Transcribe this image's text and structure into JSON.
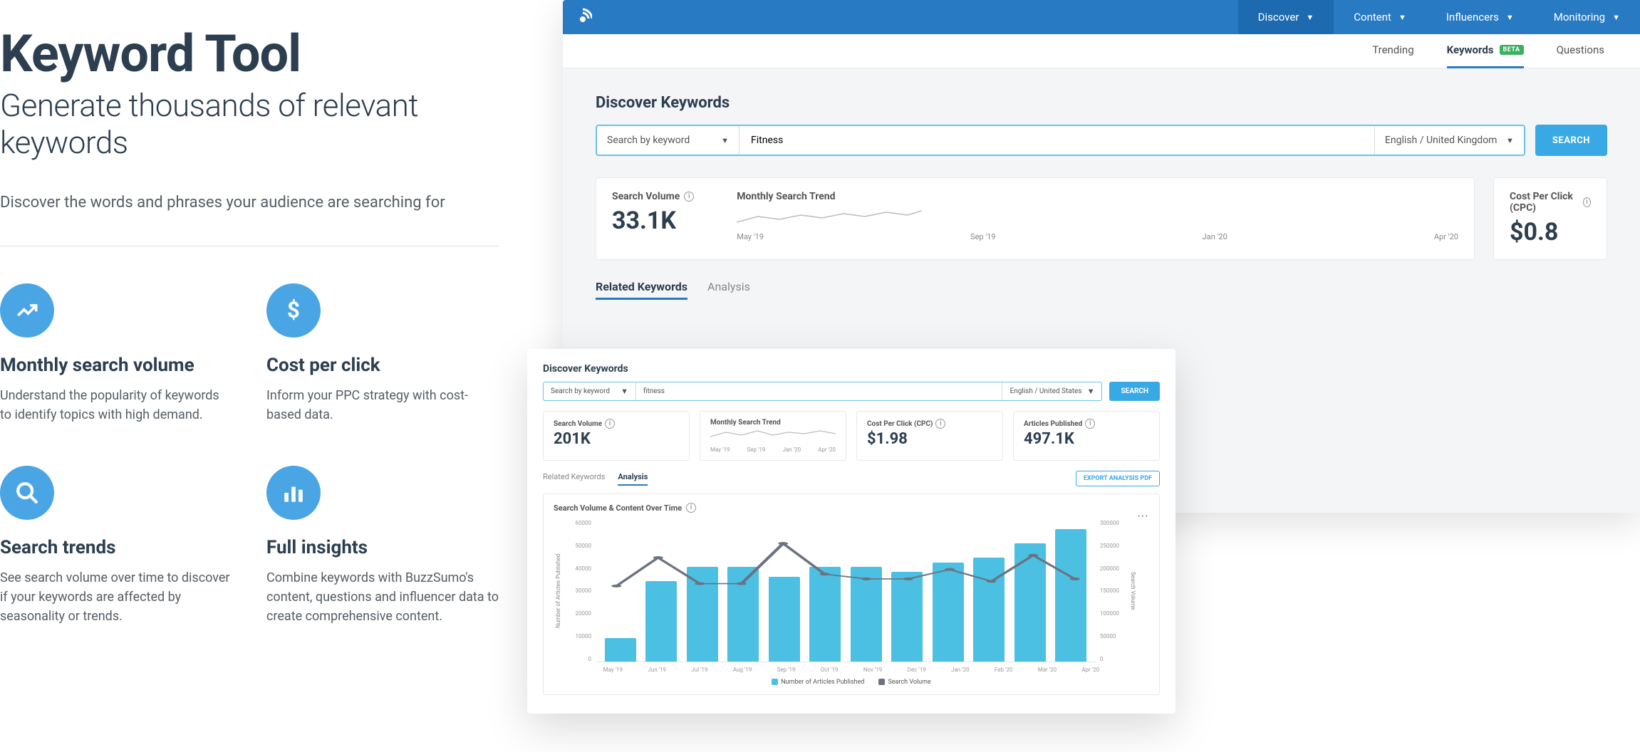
{
  "left": {
    "title": "Keyword Tool",
    "subtitle": "Generate thousands of relevant keywords",
    "tagline": "Discover the words and phrases your audience are searching for",
    "features": [
      {
        "icon": "trend",
        "title": "Monthly search volume",
        "desc": "Understand the popularity of keywords to identify topics with high demand."
      },
      {
        "icon": "dollar",
        "title": "Cost per click",
        "desc": "Inform your PPC strategy with cost-based data."
      },
      {
        "icon": "search",
        "title": "Search trends",
        "desc": "See search volume over time to discover if your keywords are affected by seasonality or trends."
      },
      {
        "icon": "bars",
        "title": "Full insights",
        "desc": "Combine keywords with BuzzSumo's content, questions and influencer data to create comprehensive content."
      }
    ]
  },
  "app1": {
    "nav": [
      "Discover",
      "Content",
      "Influencers",
      "Monitoring"
    ],
    "nav_active": "Discover",
    "subnav": {
      "trending": "Trending",
      "keywords": "Keywords",
      "beta": "BETA",
      "questions": "Questions"
    },
    "heading": "Discover Keywords",
    "search_mode": "Search by keyword",
    "search_value": "Fitness",
    "lang": "English / United Kingdom",
    "search_btn": "SEARCH",
    "metrics": {
      "sv_label": "Search Volume",
      "sv_value": "33.1K",
      "trend_label": "Monthly Search Trend",
      "trend_months": [
        "May '19",
        "Sep '19",
        "Jan '20",
        "Apr '20"
      ],
      "cpc_label": "Cost Per Click (CPC)",
      "cpc_value": "$0.8"
    },
    "result_tabs": {
      "related": "Related Keywords",
      "analysis": "Analysis"
    }
  },
  "app2": {
    "heading": "Discover Keywords",
    "search_mode": "Search by keyword",
    "search_value": "fitness",
    "lang": "English / United States",
    "search_btn": "SEARCH",
    "metrics": {
      "sv_label": "Search Volume",
      "sv_value": "201K",
      "trend_label": "Monthly Search Trend",
      "trend_months": [
        "May '19",
        "Sep '19",
        "Jan '20",
        "Apr '20"
      ],
      "cpc_label": "Cost Per Click (CPC)",
      "cpc_value": "$1.98",
      "ap_label": "Articles Published",
      "ap_value": "497.1K"
    },
    "result_tabs": {
      "related": "Related Keywords",
      "analysis": "Analysis"
    },
    "export": "EXPORT ANALYSIS PDF",
    "chart_title": "Search Volume & Content Over Time",
    "legend": {
      "bars": "Number of Articles Published",
      "line": "Search Volume"
    },
    "ylabel_left": "Number of Articles Published",
    "ylabel_right": "Search Volume"
  },
  "chart_data": {
    "type": "bar+line",
    "categories": [
      "May '19",
      "Jun '19",
      "Jul '19",
      "Aug '19",
      "Sep '19",
      "Oct '19",
      "Nov '19",
      "Dec '19",
      "Jan '20",
      "Feb '20",
      "Mar '20",
      "Apr '20"
    ],
    "bars_name": "Number of Articles Published",
    "bars_values": [
      10000,
      34000,
      40000,
      40000,
      36000,
      40000,
      40000,
      38000,
      42000,
      44000,
      50000,
      56000
    ],
    "line_name": "Search Volume",
    "line_values": [
      160000,
      220000,
      165000,
      165000,
      250000,
      185000,
      175000,
      175000,
      195000,
      170000,
      225000,
      175000
    ],
    "y_left_ticks": [
      0,
      10000,
      20000,
      30000,
      40000,
      50000,
      60000
    ],
    "y_left_range": [
      0,
      60000
    ],
    "y_right_ticks": [
      0,
      50000,
      100000,
      150000,
      200000,
      250000,
      300000
    ],
    "y_right_range": [
      0,
      300000
    ],
    "ylabel_left": "Number of Articles Published",
    "ylabel_right": "Search Volume"
  }
}
